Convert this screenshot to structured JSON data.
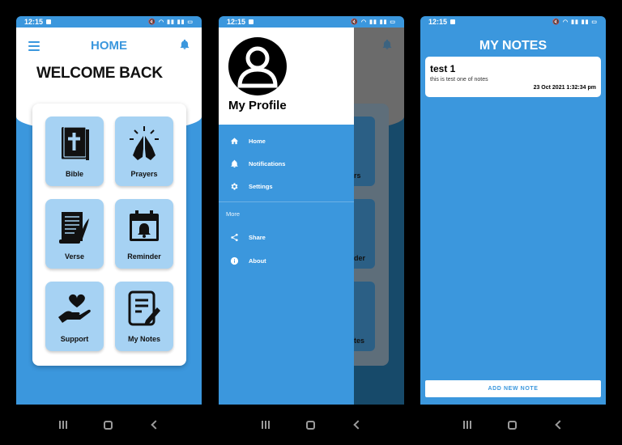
{
  "status_bar": {
    "time": "12:15",
    "icons": "volume-off wifi signal signal battery"
  },
  "home_screen": {
    "title": "HOME",
    "welcome": "WELCOME BACK",
    "tiles": [
      {
        "label": "Bible",
        "icon": "bible-icon"
      },
      {
        "label": "Prayers",
        "icon": "praying-hands-icon"
      },
      {
        "label": "Verse",
        "icon": "scroll-quill-icon"
      },
      {
        "label": "Reminder",
        "icon": "calendar-bell-icon"
      },
      {
        "label": "Support",
        "icon": "heart-hand-icon"
      },
      {
        "label": "My Notes",
        "icon": "notes-pencil-icon"
      }
    ]
  },
  "drawer": {
    "profile_name": "My Profile",
    "items": [
      {
        "label": "Home",
        "icon": "home-icon"
      },
      {
        "label": "Notifications",
        "icon": "bell-icon"
      },
      {
        "label": "Settings",
        "icon": "gear-icon"
      }
    ],
    "section_label": "More",
    "more_items": [
      {
        "label": "Share",
        "icon": "share-icon"
      },
      {
        "label": "About",
        "icon": "info-icon"
      }
    ],
    "background_fragments": [
      "rs",
      "der",
      "tes"
    ]
  },
  "notes_screen": {
    "title": "MY NOTES",
    "notes": [
      {
        "title": "test 1",
        "body": "this  is test one of notes",
        "date": "23 Oct 2021 1:32:34 pm"
      }
    ],
    "add_button": "ADD NEW NOTE"
  },
  "colors": {
    "primary": "#3b97dd",
    "tile": "#a6d2f3",
    "background": "#000000"
  }
}
